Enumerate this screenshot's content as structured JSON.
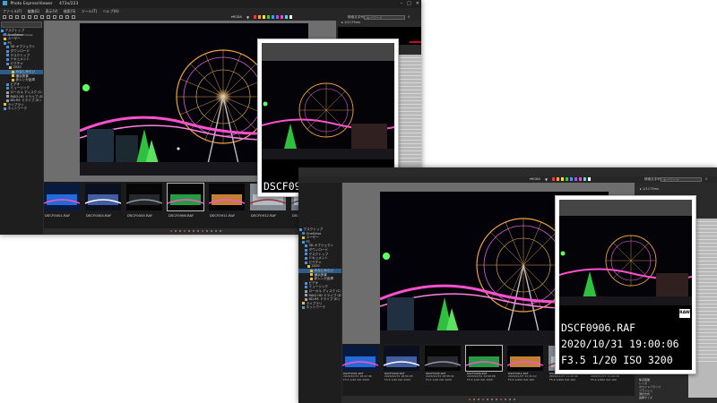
{
  "window": {
    "title": "Photo ExpressViewer",
    "count": "473x/223",
    "controls": [
      "–",
      "□",
      "✕"
    ]
  },
  "menu": [
    "ファイル(F)",
    "編集(E)",
    "表示(V)",
    "検索(S)",
    "ツール(T)",
    "ヘルプ(H)"
  ],
  "toolbar": {
    "sort_label": "▾RGBA",
    "rating_colors": [
      "#ff3030",
      "#ffa020",
      "#ffe030",
      "#30d030",
      "#30a0ff",
      "#a050ff",
      "#ff40c0",
      "#40e0e0",
      "#ffffff"
    ],
    "search_label": "検索文字列",
    "search_placeholder": "キーワード"
  },
  "sidebar": {
    "path": "D:\\Users\\Sato\\Pictures",
    "tree": [
      {
        "label": "デスクトップ",
        "color": "#3aa3e3",
        "indent": 0
      },
      {
        "label": "OneDrive",
        "color": "#3a7fd0",
        "indent": 1
      },
      {
        "label": "ユーザー",
        "color": "#e8c040",
        "indent": 1
      },
      {
        "label": "PC",
        "color": "#3aa3e3",
        "indent": 1
      },
      {
        "label": "3D オブジェクト",
        "color": "#4a8fd8",
        "indent": 2
      },
      {
        "label": "ダウンロード",
        "color": "#4a8fd8",
        "indent": 2
      },
      {
        "label": "デスクトップ",
        "color": "#4a8fd8",
        "indent": 2
      },
      {
        "label": "ドキュメント",
        "color": "#4a8fd8",
        "indent": 2
      },
      {
        "label": "ピクチャ",
        "color": "#4a8fd8",
        "indent": 2
      },
      {
        "label": "2020",
        "color": "#e8c040",
        "indent": 3
      },
      {
        "label": "みなとみらい",
        "color": "#e8c040",
        "indent": 4,
        "selected": true
      },
      {
        "label": "横浜夜景",
        "color": "#e8c040",
        "indent": 4
      },
      {
        "label": "赤レンガ倉庫",
        "color": "#e8c040",
        "indent": 4
      },
      {
        "label": "ビデオ",
        "color": "#4a8fd8",
        "indent": 2
      },
      {
        "label": "ミュージック",
        "color": "#4a8fd8",
        "indent": 2
      },
      {
        "label": "ローカル ディスク (C:)",
        "color": "#9aa0a8",
        "indent": 2
      },
      {
        "label": "RAID HD ドライブ (D:)",
        "color": "#9aa0a8",
        "indent": 2
      },
      {
        "label": "BD-RE ドライブ (E:)",
        "color": "#9aa0a8",
        "indent": 2
      },
      {
        "label": "ライブラリ",
        "color": "#e8c040",
        "indent": 1
      },
      {
        "label": "ネットワーク",
        "color": "#3aa3e3",
        "indent": 1
      }
    ]
  },
  "thumbnails": [
    {
      "name": "DSCF0001.RAF",
      "date": "2020/10/31 18:47:46",
      "exif": "F3.5 1/20 ISO 3200"
    },
    {
      "name": "DSCF0004.RAF",
      "date": "2020/10/31 18:52:05",
      "exif": "F3.5 1/20 ISO 3200"
    },
    {
      "name": "DSCF0005.RAF",
      "date": "2020/10/31 18:58:41",
      "exif": "F3.5 1/20 ISO 3200"
    },
    {
      "name": "DSCF0906.RAF",
      "date": "2020/10/31 19:00:06",
      "exif": "F3.5 1/20 ISO 3200",
      "selected": true
    },
    {
      "name": "DSCF0911.RAF",
      "date": "2020/11/07 11:31:12",
      "exif": "F5.6 1/900 ISO 160"
    },
    {
      "name": "DSCF0912.RAF",
      "date": "2020/11/07 11:32:40",
      "exif": "F5.6 1/900 ISO 160"
    },
    {
      "name": "DSCF0917.RAF",
      "date": "2020/11/07 11:40:18",
      "exif": "F5.6 1/900 ISO 160"
    }
  ],
  "popup_small": {
    "title": "DSCF0906.RAF",
    "badge": "RAW"
  },
  "popup_large": {
    "title": "DSCF0906.RAF",
    "date": "2020/10/31 19:00:06",
    "exif": "F3.5 1/20 ISO 3200",
    "badge": "RAW"
  },
  "right_panel": {
    "header": "▸ 1/1173ms",
    "items": [
      "撮影日時",
      "メーカー",
      "機種",
      "F値",
      "露出時間",
      "ISO感度",
      "焦点距離",
      "レンズ",
      "ホワイトバランス",
      "フラッシュ",
      "測光方式",
      "画像サイズ"
    ]
  }
}
